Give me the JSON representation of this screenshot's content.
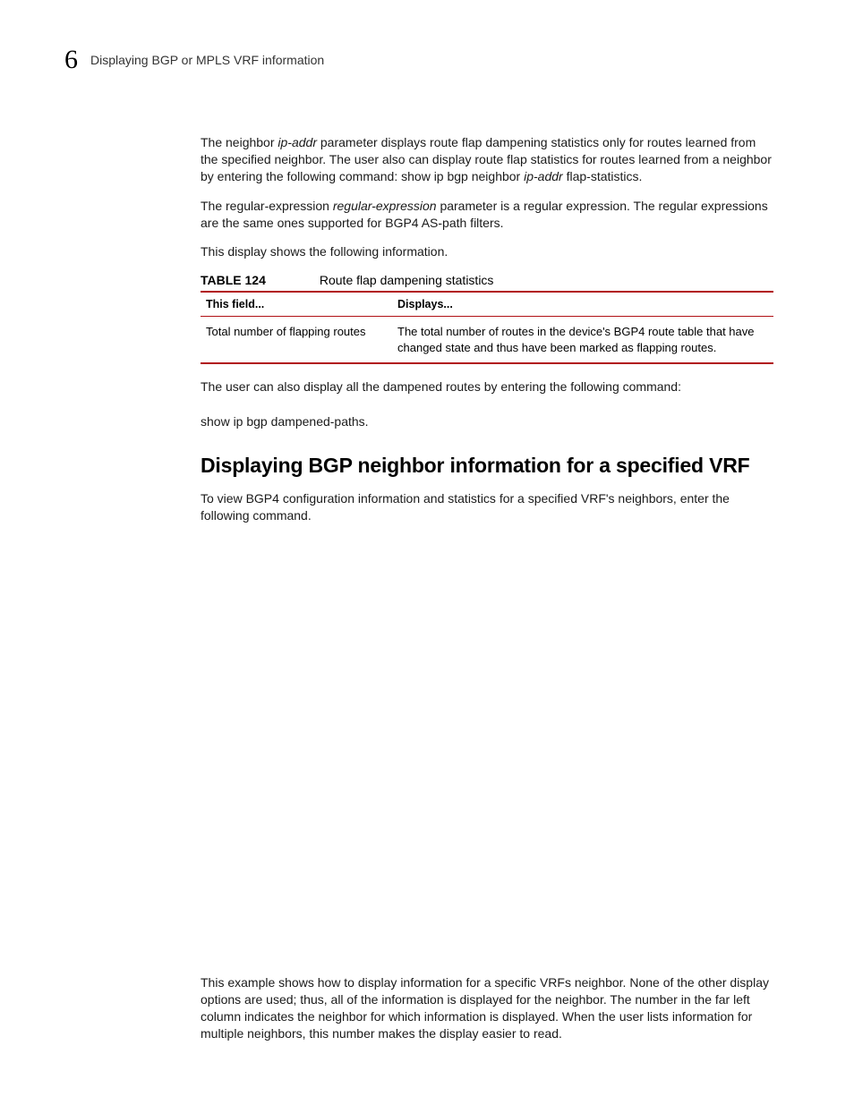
{
  "header": {
    "chapter_number": "6",
    "chapter_title": "Displaying BGP or MPLS VRF information"
  },
  "p1_pre": "The neighbor ",
  "p1_em1": "ip-addr",
  "p1_mid": " parameter displays route flap dampening statistics only for routes learned from the specified neighbor. The user also can display route flap statistics for routes learned from a neighbor by entering the following command: show ip bgp neighbor ",
  "p1_em2": "ip-addr",
  "p1_post": " flap-statistics.",
  "p2_pre": "The regular-expression ",
  "p2_em": "regular-expression",
  "p2_post": " parameter is a regular expression. The regular expressions are the same ones supported for BGP4 AS-path filters.",
  "p3": "This display shows the following information.",
  "table": {
    "label": "TABLE 124",
    "caption": "Route flap dampening statistics",
    "head_col1": "This field...",
    "head_col2": "Displays...",
    "row1_col1": "Total number of flapping routes",
    "row1_col2": "The total number of routes in the device's BGP4 route table that have changed state and thus have been marked as flapping routes."
  },
  "p4": "The user can also display all the dampened routes by entering the following command:",
  "p5": "show ip bgp dampened-paths.",
  "section_heading": "Displaying BGP neighbor information for a specified VRF",
  "p6": "To view BGP4 configuration information and statistics for a specified VRF's neighbors, enter the following command.",
  "p7": "This example shows how to display information for a specific VRFs neighbor. None of the other display options are used; thus, all of the information is displayed for the neighbor. The number in the far left column indicates the neighbor for which information is displayed. When the user lists information for multiple neighbors, this number makes the display easier to read."
}
